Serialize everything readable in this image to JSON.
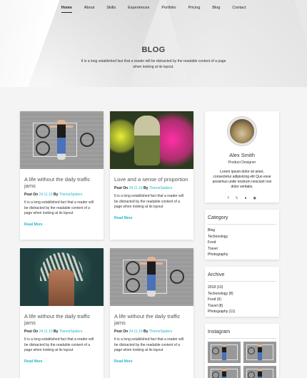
{
  "nav": {
    "items": [
      "Home",
      "About",
      "Skills",
      "Experiences",
      "Portfolio",
      "Pricing",
      "Blog",
      "Contact"
    ],
    "active": "Home"
  },
  "hero": {
    "title": "BLOG",
    "subtitle": "It is a long established fact that a reader will be distracted by the readable content of a page when looking at its layout."
  },
  "posts": [
    {
      "title": "A life without the daily traffic jams",
      "meta_prefix": "Post On",
      "date": "24.11.19",
      "by": "By",
      "author": "ThemeSpiders",
      "excerpt": "It is a long established fact that a reader will be distracted by the readable content of a page when looking at its layout",
      "read_more": "Read More"
    },
    {
      "title": "Love and a sense of proportion",
      "meta_prefix": "Post On",
      "date": "24.11.19",
      "by": "By",
      "author": "ThemeSpiders",
      "excerpt": "It is a long established fact that a reader will be distracted by the readable content of a page when looking at its layout",
      "read_more": "Read More"
    },
    {
      "title": "A life without the daily traffic jams",
      "meta_prefix": "Post On",
      "date": "24.11.19",
      "by": "By",
      "author": "ThemeSpiders",
      "excerpt": "It is a long established fact that a reader will be distracted by the readable content of a page when looking at its layout",
      "read_more": "Read More"
    },
    {
      "title": "A life without the daily traffic jams",
      "meta_prefix": "Post On",
      "date": "24.11.19",
      "by": "By",
      "author": "ThemeSpiders",
      "excerpt": "It is a long established fact that a reader will be distracted by the readable content of a page when looking at its layout",
      "read_more": "Read More"
    }
  ],
  "profile": {
    "name": "Alex Smith",
    "role": "Product Designer",
    "bio": "Lorem ipsum dolor sit amet, consectetur adipisicing elit Quo esse possimus unde nostrum nesciunt non dolor veritatis.",
    "socials": [
      "facebook-icon",
      "twitter-icon",
      "github-icon",
      "dribbble-icon"
    ]
  },
  "category": {
    "title": "Category",
    "items": [
      "Blog",
      "Techonology",
      "Food",
      "Travel",
      "Photography"
    ]
  },
  "archive": {
    "title": "Archive",
    "items": [
      "2018 (10)",
      "Techonology (8)",
      "Food (6)",
      "Travel (8)",
      "Photography (11)"
    ]
  },
  "instagram": {
    "title": "Instagram"
  },
  "colors": {
    "accent": "#23b7c9",
    "text": "#333333",
    "background": "#f4f4f4"
  }
}
